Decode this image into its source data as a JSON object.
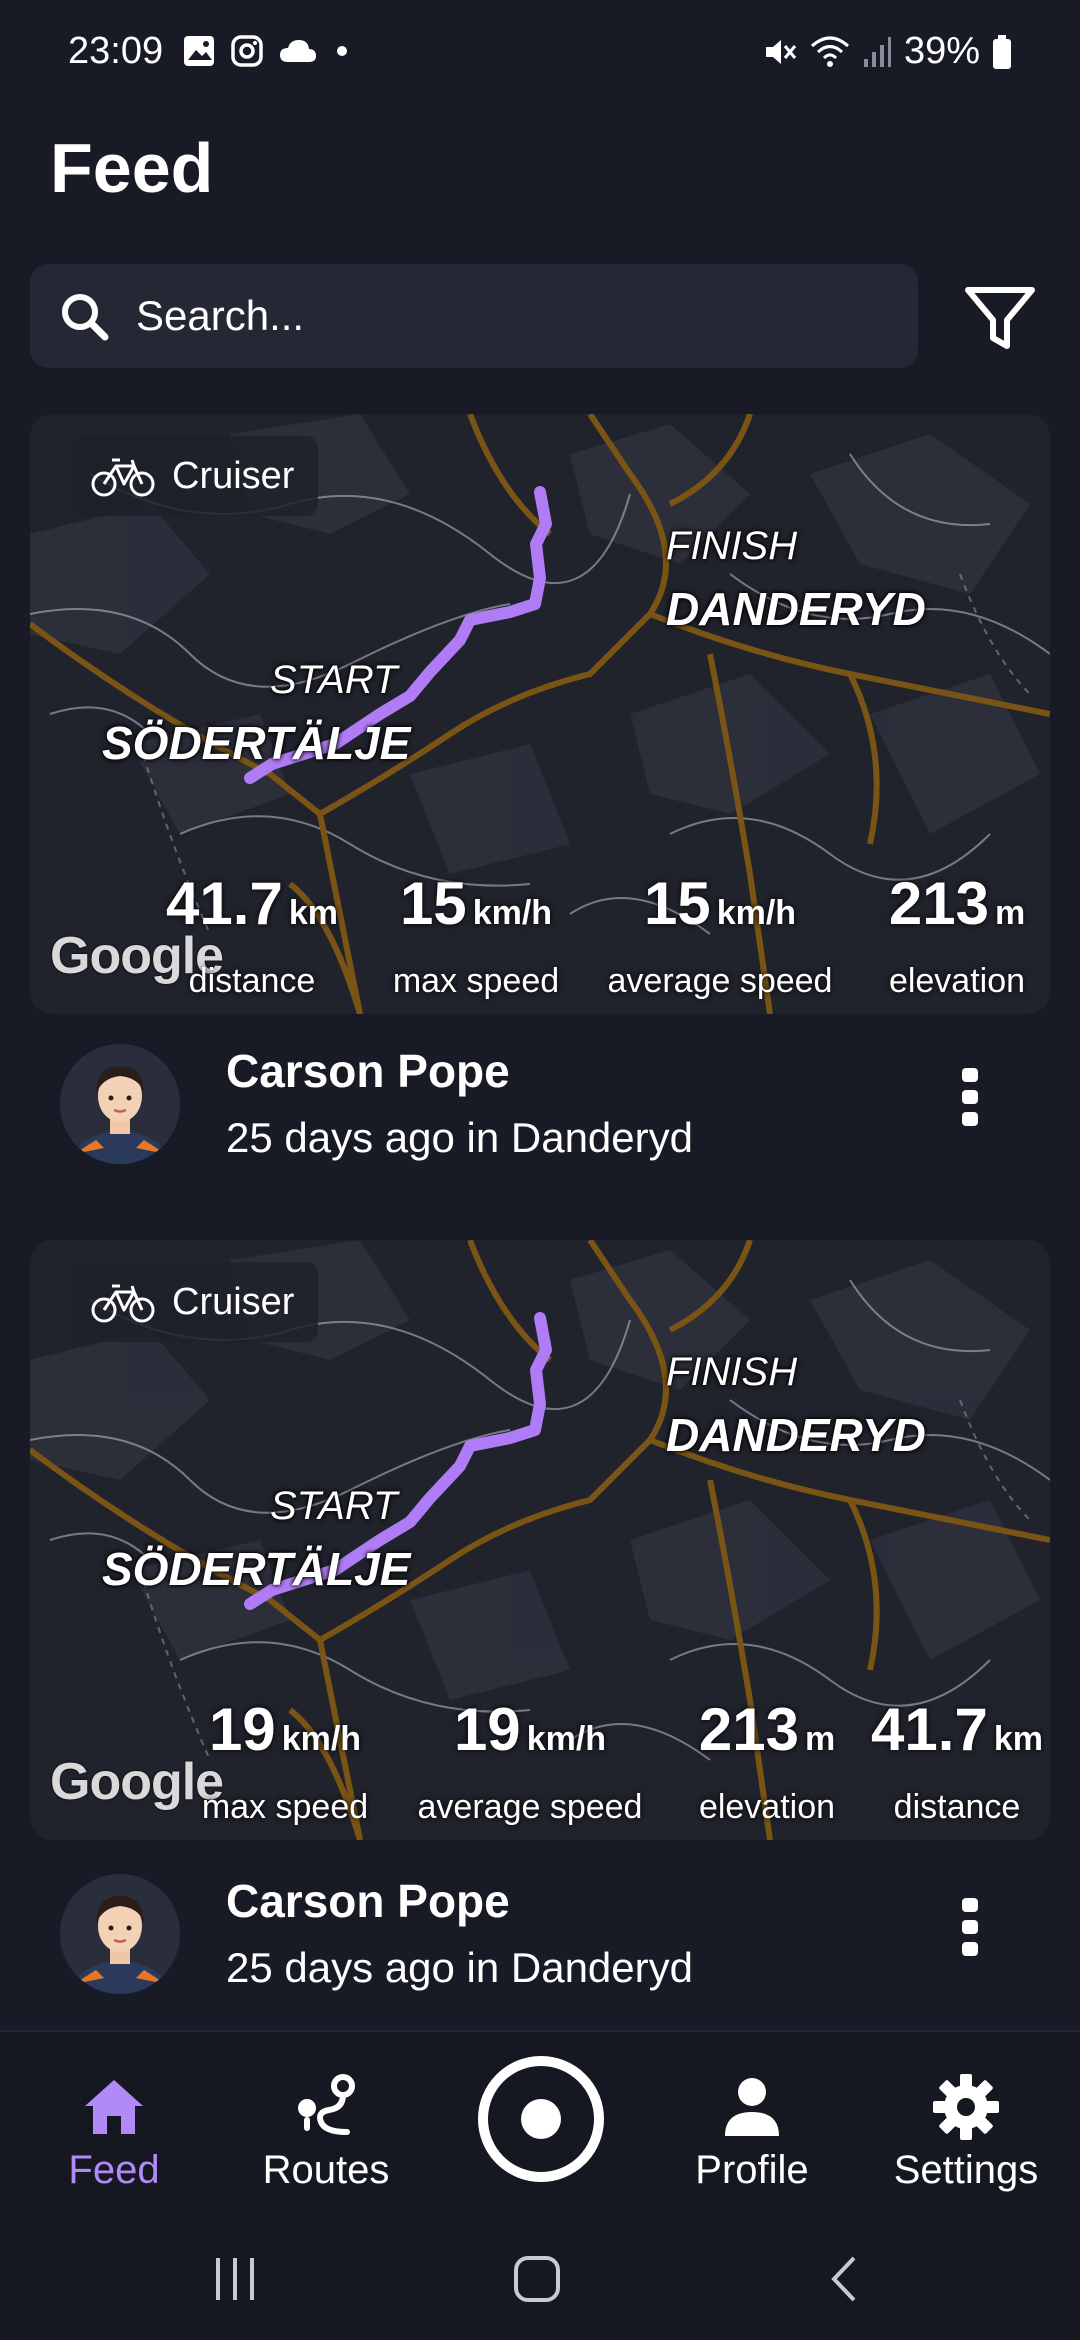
{
  "status_bar": {
    "time": "23:09",
    "battery": "39%"
  },
  "header": {
    "title": "Feed"
  },
  "search": {
    "placeholder": "Search..."
  },
  "cards": [
    {
      "badge": "Cruiser",
      "start_caption": "START",
      "start_place": "SÖDERTÄLJE",
      "finish_caption": "FINISH",
      "finish_place": "DANDERYD",
      "map_attribution": "Google",
      "stats": [
        {
          "value": "41.7",
          "unit": "km",
          "label": "distance"
        },
        {
          "value": "15",
          "unit": "km/h",
          "label": "max speed"
        },
        {
          "value": "15",
          "unit": "km/h",
          "label": "average speed"
        },
        {
          "value": "213",
          "unit": "m",
          "label": "elevation"
        }
      ],
      "author": "Carson Pope",
      "subtitle": "25 days ago in Danderyd"
    },
    {
      "badge": "Cruiser",
      "start_caption": "START",
      "start_place": "SÖDERTÄLJE",
      "finish_caption": "FINISH",
      "finish_place": "DANDERYD",
      "map_attribution": "Google",
      "stats": [
        {
          "value": "19",
          "unit": "km/h",
          "label": "max speed"
        },
        {
          "value": "19",
          "unit": "km/h",
          "label": "average speed"
        },
        {
          "value": "213",
          "unit": "m",
          "label": "elevation"
        },
        {
          "value": "41.7",
          "unit": "km",
          "label": "distance"
        }
      ],
      "author": "Carson Pope",
      "subtitle": "25 days ago in Danderyd"
    }
  ],
  "bottom_nav": {
    "items": [
      {
        "label": "Feed",
        "icon": "home-icon",
        "active": true
      },
      {
        "label": "Routes",
        "icon": "route-icon",
        "active": false
      },
      {
        "label": "Profile",
        "icon": "person-icon",
        "active": false
      },
      {
        "label": "Settings",
        "icon": "gear-icon",
        "active": false
      }
    ],
    "record_icon": "record-icon"
  },
  "colors": {
    "background": "#181b26",
    "accent": "#b28af7",
    "route": "#b07cf5",
    "road": "#7a5414"
  }
}
